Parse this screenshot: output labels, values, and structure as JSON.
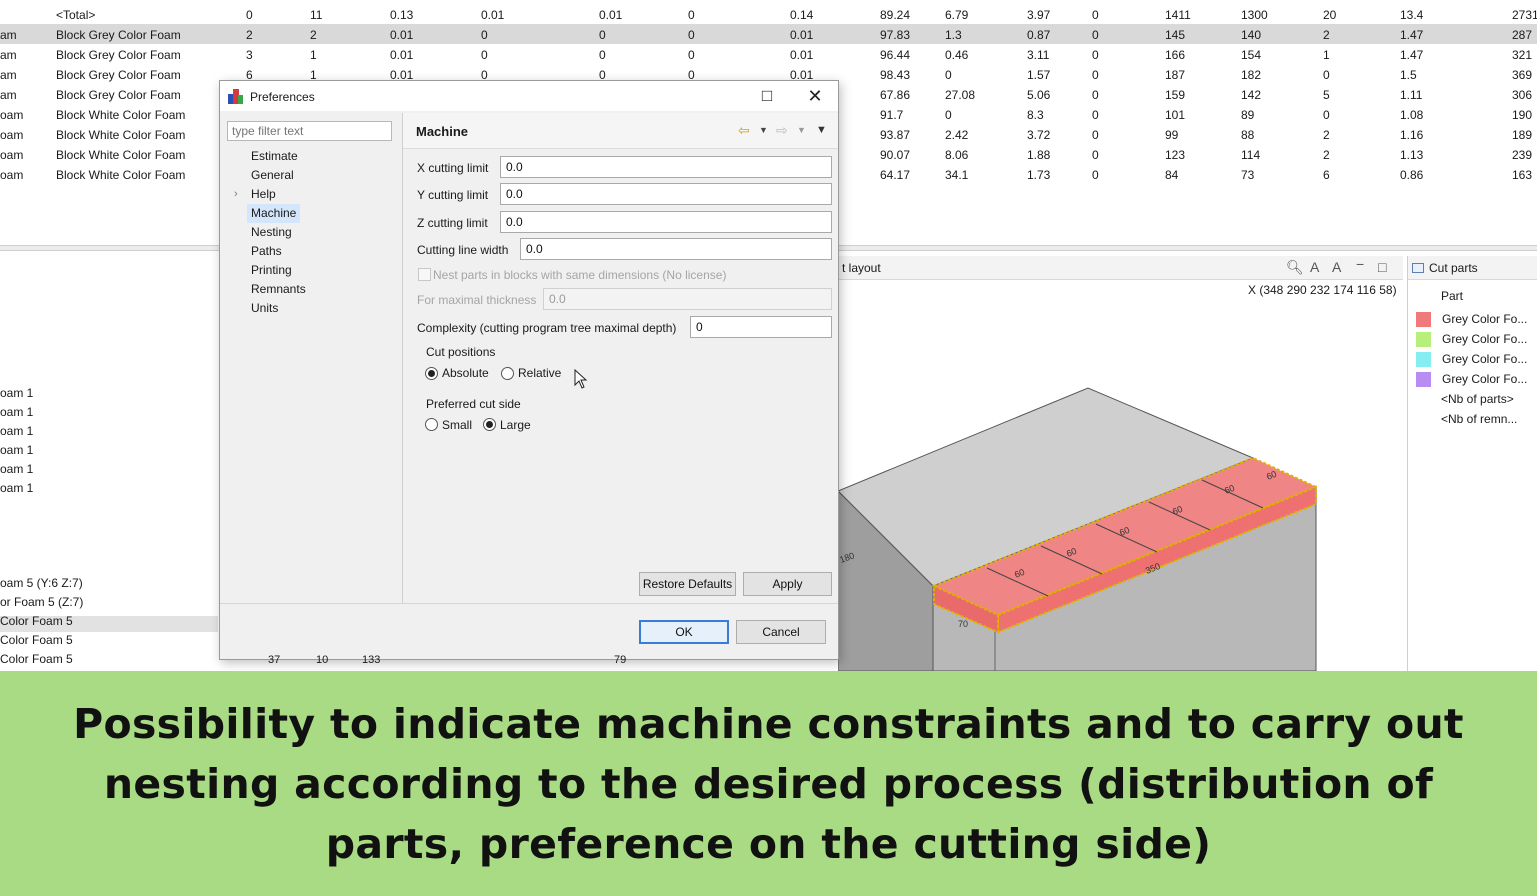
{
  "table": {
    "rows": [
      {
        "name": "",
        "desc": "<Total>",
        "c": [
          "0",
          "11",
          "0.13",
          "0.01",
          "0.01",
          "0",
          "0.14",
          "89.24",
          "6.79",
          "3.97",
          "0",
          "1411",
          "1300",
          "20",
          "13.4",
          "2731"
        ]
      },
      {
        "name": "am",
        "desc": "Block Grey Color Foam",
        "selected": true,
        "c": [
          "2",
          "2",
          "0.01",
          "0",
          "0",
          "0",
          "0.01",
          "97.83",
          "1.3",
          "0.87",
          "0",
          "145",
          "140",
          "2",
          "1.47",
          "287"
        ]
      },
      {
        "name": "am",
        "desc": "Block Grey Color Foam",
        "c": [
          "3",
          "1",
          "0.01",
          "0",
          "0",
          "0",
          "0.01",
          "96.44",
          "0.46",
          "3.11",
          "0",
          "166",
          "154",
          "1",
          "1.47",
          "321"
        ]
      },
      {
        "name": "am",
        "desc": "Block Grey Color Foam",
        "c": [
          "6",
          "1",
          "0.01",
          "0",
          "0",
          "0",
          "0.01",
          "98.43",
          "0",
          "1.57",
          "0",
          "187",
          "182",
          "0",
          "1.5",
          "369"
        ]
      },
      {
        "name": "am",
        "desc": "Block Grey Color Foam",
        "c": [
          "",
          "",
          "",
          "",
          "",
          "",
          "",
          "67.86",
          "27.08",
          "5.06",
          "0",
          "159",
          "142",
          "5",
          "1.11",
          "306"
        ]
      },
      {
        "name": "oam",
        "desc": "Block White Color Foam",
        "c": [
          "",
          "",
          "",
          "",
          "",
          "",
          "",
          "91.7",
          "0",
          "8.3",
          "0",
          "101",
          "89",
          "0",
          "1.08",
          "190"
        ]
      },
      {
        "name": "oam",
        "desc": "Block White Color Foam",
        "c": [
          "",
          "",
          "",
          "",
          "",
          "",
          "",
          "93.87",
          "2.42",
          "3.72",
          "0",
          "99",
          "88",
          "2",
          "1.16",
          "189"
        ]
      },
      {
        "name": "oam",
        "desc": "Block White Color Foam",
        "c": [
          "",
          "",
          "",
          "",
          "",
          "",
          "",
          "90.07",
          "8.06",
          "1.88",
          "0",
          "123",
          "114",
          "2",
          "1.13",
          "239"
        ]
      },
      {
        "name": "oam",
        "desc": "Block White Color Foam",
        "c": [
          "",
          "",
          "",
          "",
          "",
          "",
          "",
          "64.17",
          "34.1",
          "1.73",
          "0",
          "84",
          "73",
          "6",
          "0.86",
          "163"
        ]
      }
    ]
  },
  "left_list": {
    "group1": [
      "oam 1",
      "oam 1",
      "oam 1",
      "oam 1",
      "oam 1",
      "oam 1"
    ],
    "group2": [
      "oam 5 (Y:6 Z:7)",
      "or Foam 5 (Z:7)",
      "Color Foam 5",
      "Color Foam 5",
      "Color Foam 5"
    ],
    "footer_values": [
      "37",
      "10",
      "133",
      "79"
    ]
  },
  "view": {
    "tab": "t layout",
    "coords": "X (348 290 232 174 116 58)",
    "dim_labels": [
      "180",
      "70",
      "350",
      "60",
      "60",
      "60",
      "60",
      "60",
      "60"
    ]
  },
  "cut_parts": {
    "tab": "Cut parts",
    "header": "Part",
    "parts": [
      {
        "label": "Grey Color Fo...",
        "color": "#f07a7a"
      },
      {
        "label": "Grey Color Fo...",
        "color": "#b6ef7c"
      },
      {
        "label": "Grey Color Fo...",
        "color": "#85eef0"
      },
      {
        "label": "Grey Color Fo...",
        "color": "#b88cf2"
      }
    ],
    "extra": [
      "<Nb of parts>",
      "<Nb of remn..."
    ]
  },
  "dialog": {
    "title": "Preferences",
    "filter_placeholder": "type filter text",
    "nav": [
      "Estimate",
      "General",
      "Help",
      "Machine",
      "Nesting",
      "Paths",
      "Printing",
      "Remnants",
      "Units"
    ],
    "active_nav": "Machine",
    "page_title": "Machine",
    "fields": {
      "x_label": "X cutting limit",
      "x_value": "0.0",
      "y_label": "Y cutting limit",
      "y_value": "0.0",
      "z_label": "Z cutting limit",
      "z_value": "0.0",
      "width_label": "Cutting line width",
      "width_value": "0.0",
      "nest_label": "Nest parts in blocks with same dimensions (No license)",
      "thickness_label": "For maximal thickness",
      "thickness_value": "0.0",
      "complexity_label": "Complexity (cutting program tree maximal depth)",
      "complexity_value": "0"
    },
    "cut_positions": {
      "label": "Cut positions",
      "options": [
        "Absolute",
        "Relative"
      ],
      "selected": "Absolute"
    },
    "cut_side": {
      "label": "Preferred cut side",
      "options": [
        "Small",
        "Large"
      ],
      "selected": "Large"
    },
    "buttons": {
      "restore": "Restore Defaults",
      "apply": "Apply",
      "ok": "OK",
      "cancel": "Cancel"
    }
  },
  "caption": "Possibility to indicate machine constraints and to carry out nesting according to the desired process (distribution of parts, preference on the cutting side)"
}
